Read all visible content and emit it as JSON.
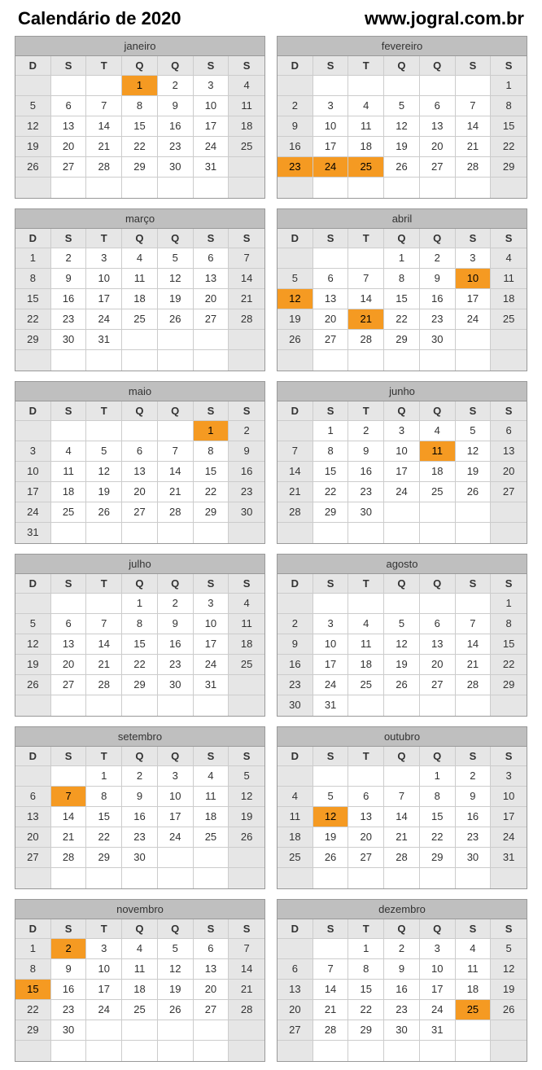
{
  "title": "Calendário de 2020",
  "site": "www.jogral.com.br",
  "weekday_labels": [
    "D",
    "S",
    "T",
    "Q",
    "Q",
    "S",
    "S"
  ],
  "months": [
    {
      "name": "janeiro",
      "weeks": [
        [
          "",
          "",
          "",
          "1",
          "2",
          "3",
          "4"
        ],
        [
          "5",
          "6",
          "7",
          "8",
          "9",
          "10",
          "11"
        ],
        [
          "12",
          "13",
          "14",
          "15",
          "16",
          "17",
          "18"
        ],
        [
          "19",
          "20",
          "21",
          "22",
          "23",
          "24",
          "25"
        ],
        [
          "26",
          "27",
          "28",
          "29",
          "30",
          "31",
          ""
        ],
        [
          "",
          "",
          "",
          "",
          "",
          "",
          ""
        ]
      ],
      "highlights": [
        "1"
      ]
    },
    {
      "name": "fevereiro",
      "weeks": [
        [
          "",
          "",
          "",
          "",
          "",
          "",
          "1"
        ],
        [
          "2",
          "3",
          "4",
          "5",
          "6",
          "7",
          "8"
        ],
        [
          "9",
          "10",
          "11",
          "12",
          "13",
          "14",
          "15"
        ],
        [
          "16",
          "17",
          "18",
          "19",
          "20",
          "21",
          "22"
        ],
        [
          "23",
          "24",
          "25",
          "26",
          "27",
          "28",
          "29"
        ],
        [
          "",
          "",
          "",
          "",
          "",
          "",
          ""
        ]
      ],
      "highlights": [
        "23",
        "24",
        "25"
      ]
    },
    {
      "name": "março",
      "weeks": [
        [
          "1",
          "2",
          "3",
          "4",
          "5",
          "6",
          "7"
        ],
        [
          "8",
          "9",
          "10",
          "11",
          "12",
          "13",
          "14"
        ],
        [
          "15",
          "16",
          "17",
          "18",
          "19",
          "20",
          "21"
        ],
        [
          "22",
          "23",
          "24",
          "25",
          "26",
          "27",
          "28"
        ],
        [
          "29",
          "30",
          "31",
          "",
          "",
          "",
          ""
        ],
        [
          "",
          "",
          "",
          "",
          "",
          "",
          ""
        ]
      ],
      "highlights": []
    },
    {
      "name": "abril",
      "weeks": [
        [
          "",
          "",
          "",
          "1",
          "2",
          "3",
          "4"
        ],
        [
          "5",
          "6",
          "7",
          "8",
          "9",
          "10",
          "11"
        ],
        [
          "12",
          "13",
          "14",
          "15",
          "16",
          "17",
          "18"
        ],
        [
          "19",
          "20",
          "21",
          "22",
          "23",
          "24",
          "25"
        ],
        [
          "26",
          "27",
          "28",
          "29",
          "30",
          "",
          ""
        ],
        [
          "",
          "",
          "",
          "",
          "",
          "",
          ""
        ]
      ],
      "highlights": [
        "10",
        "12",
        "21"
      ]
    },
    {
      "name": "maio",
      "weeks": [
        [
          "",
          "",
          "",
          "",
          "",
          "1",
          "2"
        ],
        [
          "3",
          "4",
          "5",
          "6",
          "7",
          "8",
          "9"
        ],
        [
          "10",
          "11",
          "12",
          "13",
          "14",
          "15",
          "16"
        ],
        [
          "17",
          "18",
          "19",
          "20",
          "21",
          "22",
          "23"
        ],
        [
          "24",
          "25",
          "26",
          "27",
          "28",
          "29",
          "30"
        ],
        [
          "31",
          "",
          "",
          "",
          "",
          "",
          ""
        ]
      ],
      "highlights": [
        "1"
      ]
    },
    {
      "name": "junho",
      "weeks": [
        [
          "",
          "1",
          "2",
          "3",
          "4",
          "5",
          "6"
        ],
        [
          "7",
          "8",
          "9",
          "10",
          "11",
          "12",
          "13"
        ],
        [
          "14",
          "15",
          "16",
          "17",
          "18",
          "19",
          "20"
        ],
        [
          "21",
          "22",
          "23",
          "24",
          "25",
          "26",
          "27"
        ],
        [
          "28",
          "29",
          "30",
          "",
          "",
          "",
          ""
        ],
        [
          "",
          "",
          "",
          "",
          "",
          "",
          ""
        ]
      ],
      "highlights": [
        "11"
      ]
    },
    {
      "name": "julho",
      "weeks": [
        [
          "",
          "",
          "",
          "1",
          "2",
          "3",
          "4"
        ],
        [
          "5",
          "6",
          "7",
          "8",
          "9",
          "10",
          "11"
        ],
        [
          "12",
          "13",
          "14",
          "15",
          "16",
          "17",
          "18"
        ],
        [
          "19",
          "20",
          "21",
          "22",
          "23",
          "24",
          "25"
        ],
        [
          "26",
          "27",
          "28",
          "29",
          "30",
          "31",
          ""
        ],
        [
          "",
          "",
          "",
          "",
          "",
          "",
          ""
        ]
      ],
      "highlights": []
    },
    {
      "name": "agosto",
      "weeks": [
        [
          "",
          "",
          "",
          "",
          "",
          "",
          "1"
        ],
        [
          "2",
          "3",
          "4",
          "5",
          "6",
          "7",
          "8"
        ],
        [
          "9",
          "10",
          "11",
          "12",
          "13",
          "14",
          "15"
        ],
        [
          "16",
          "17",
          "18",
          "19",
          "20",
          "21",
          "22"
        ],
        [
          "23",
          "24",
          "25",
          "26",
          "27",
          "28",
          "29"
        ],
        [
          "30",
          "31",
          "",
          "",
          "",
          "",
          ""
        ]
      ],
      "highlights": []
    },
    {
      "name": "setembro",
      "weeks": [
        [
          "",
          "",
          "1",
          "2",
          "3",
          "4",
          "5"
        ],
        [
          "6",
          "7",
          "8",
          "9",
          "10",
          "11",
          "12"
        ],
        [
          "13",
          "14",
          "15",
          "16",
          "17",
          "18",
          "19"
        ],
        [
          "20",
          "21",
          "22",
          "23",
          "24",
          "25",
          "26"
        ],
        [
          "27",
          "28",
          "29",
          "30",
          "",
          "",
          ""
        ],
        [
          "",
          "",
          "",
          "",
          "",
          "",
          ""
        ]
      ],
      "highlights": [
        "7"
      ]
    },
    {
      "name": "outubro",
      "weeks": [
        [
          "",
          "",
          "",
          "",
          "1",
          "2",
          "3"
        ],
        [
          "4",
          "5",
          "6",
          "7",
          "8",
          "9",
          "10"
        ],
        [
          "11",
          "12",
          "13",
          "14",
          "15",
          "16",
          "17"
        ],
        [
          "18",
          "19",
          "20",
          "21",
          "22",
          "23",
          "24"
        ],
        [
          "25",
          "26",
          "27",
          "28",
          "29",
          "30",
          "31"
        ],
        [
          "",
          "",
          "",
          "",
          "",
          "",
          ""
        ]
      ],
      "highlights": [
        "12"
      ]
    },
    {
      "name": "novembro",
      "weeks": [
        [
          "1",
          "2",
          "3",
          "4",
          "5",
          "6",
          "7"
        ],
        [
          "8",
          "9",
          "10",
          "11",
          "12",
          "13",
          "14"
        ],
        [
          "15",
          "16",
          "17",
          "18",
          "19",
          "20",
          "21"
        ],
        [
          "22",
          "23",
          "24",
          "25",
          "26",
          "27",
          "28"
        ],
        [
          "29",
          "30",
          "",
          "",
          "",
          "",
          ""
        ],
        [
          "",
          "",
          "",
          "",
          "",
          "",
          ""
        ]
      ],
      "highlights": [
        "2",
        "15"
      ]
    },
    {
      "name": "dezembro",
      "weeks": [
        [
          "",
          "",
          "1",
          "2",
          "3",
          "4",
          "5"
        ],
        [
          "6",
          "7",
          "8",
          "9",
          "10",
          "11",
          "12"
        ],
        [
          "13",
          "14",
          "15",
          "16",
          "17",
          "18",
          "19"
        ],
        [
          "20",
          "21",
          "22",
          "23",
          "24",
          "25",
          "26"
        ],
        [
          "27",
          "28",
          "29",
          "30",
          "31",
          "",
          ""
        ],
        [
          "",
          "",
          "",
          "",
          "",
          "",
          ""
        ]
      ],
      "highlights": [
        "25"
      ]
    }
  ]
}
